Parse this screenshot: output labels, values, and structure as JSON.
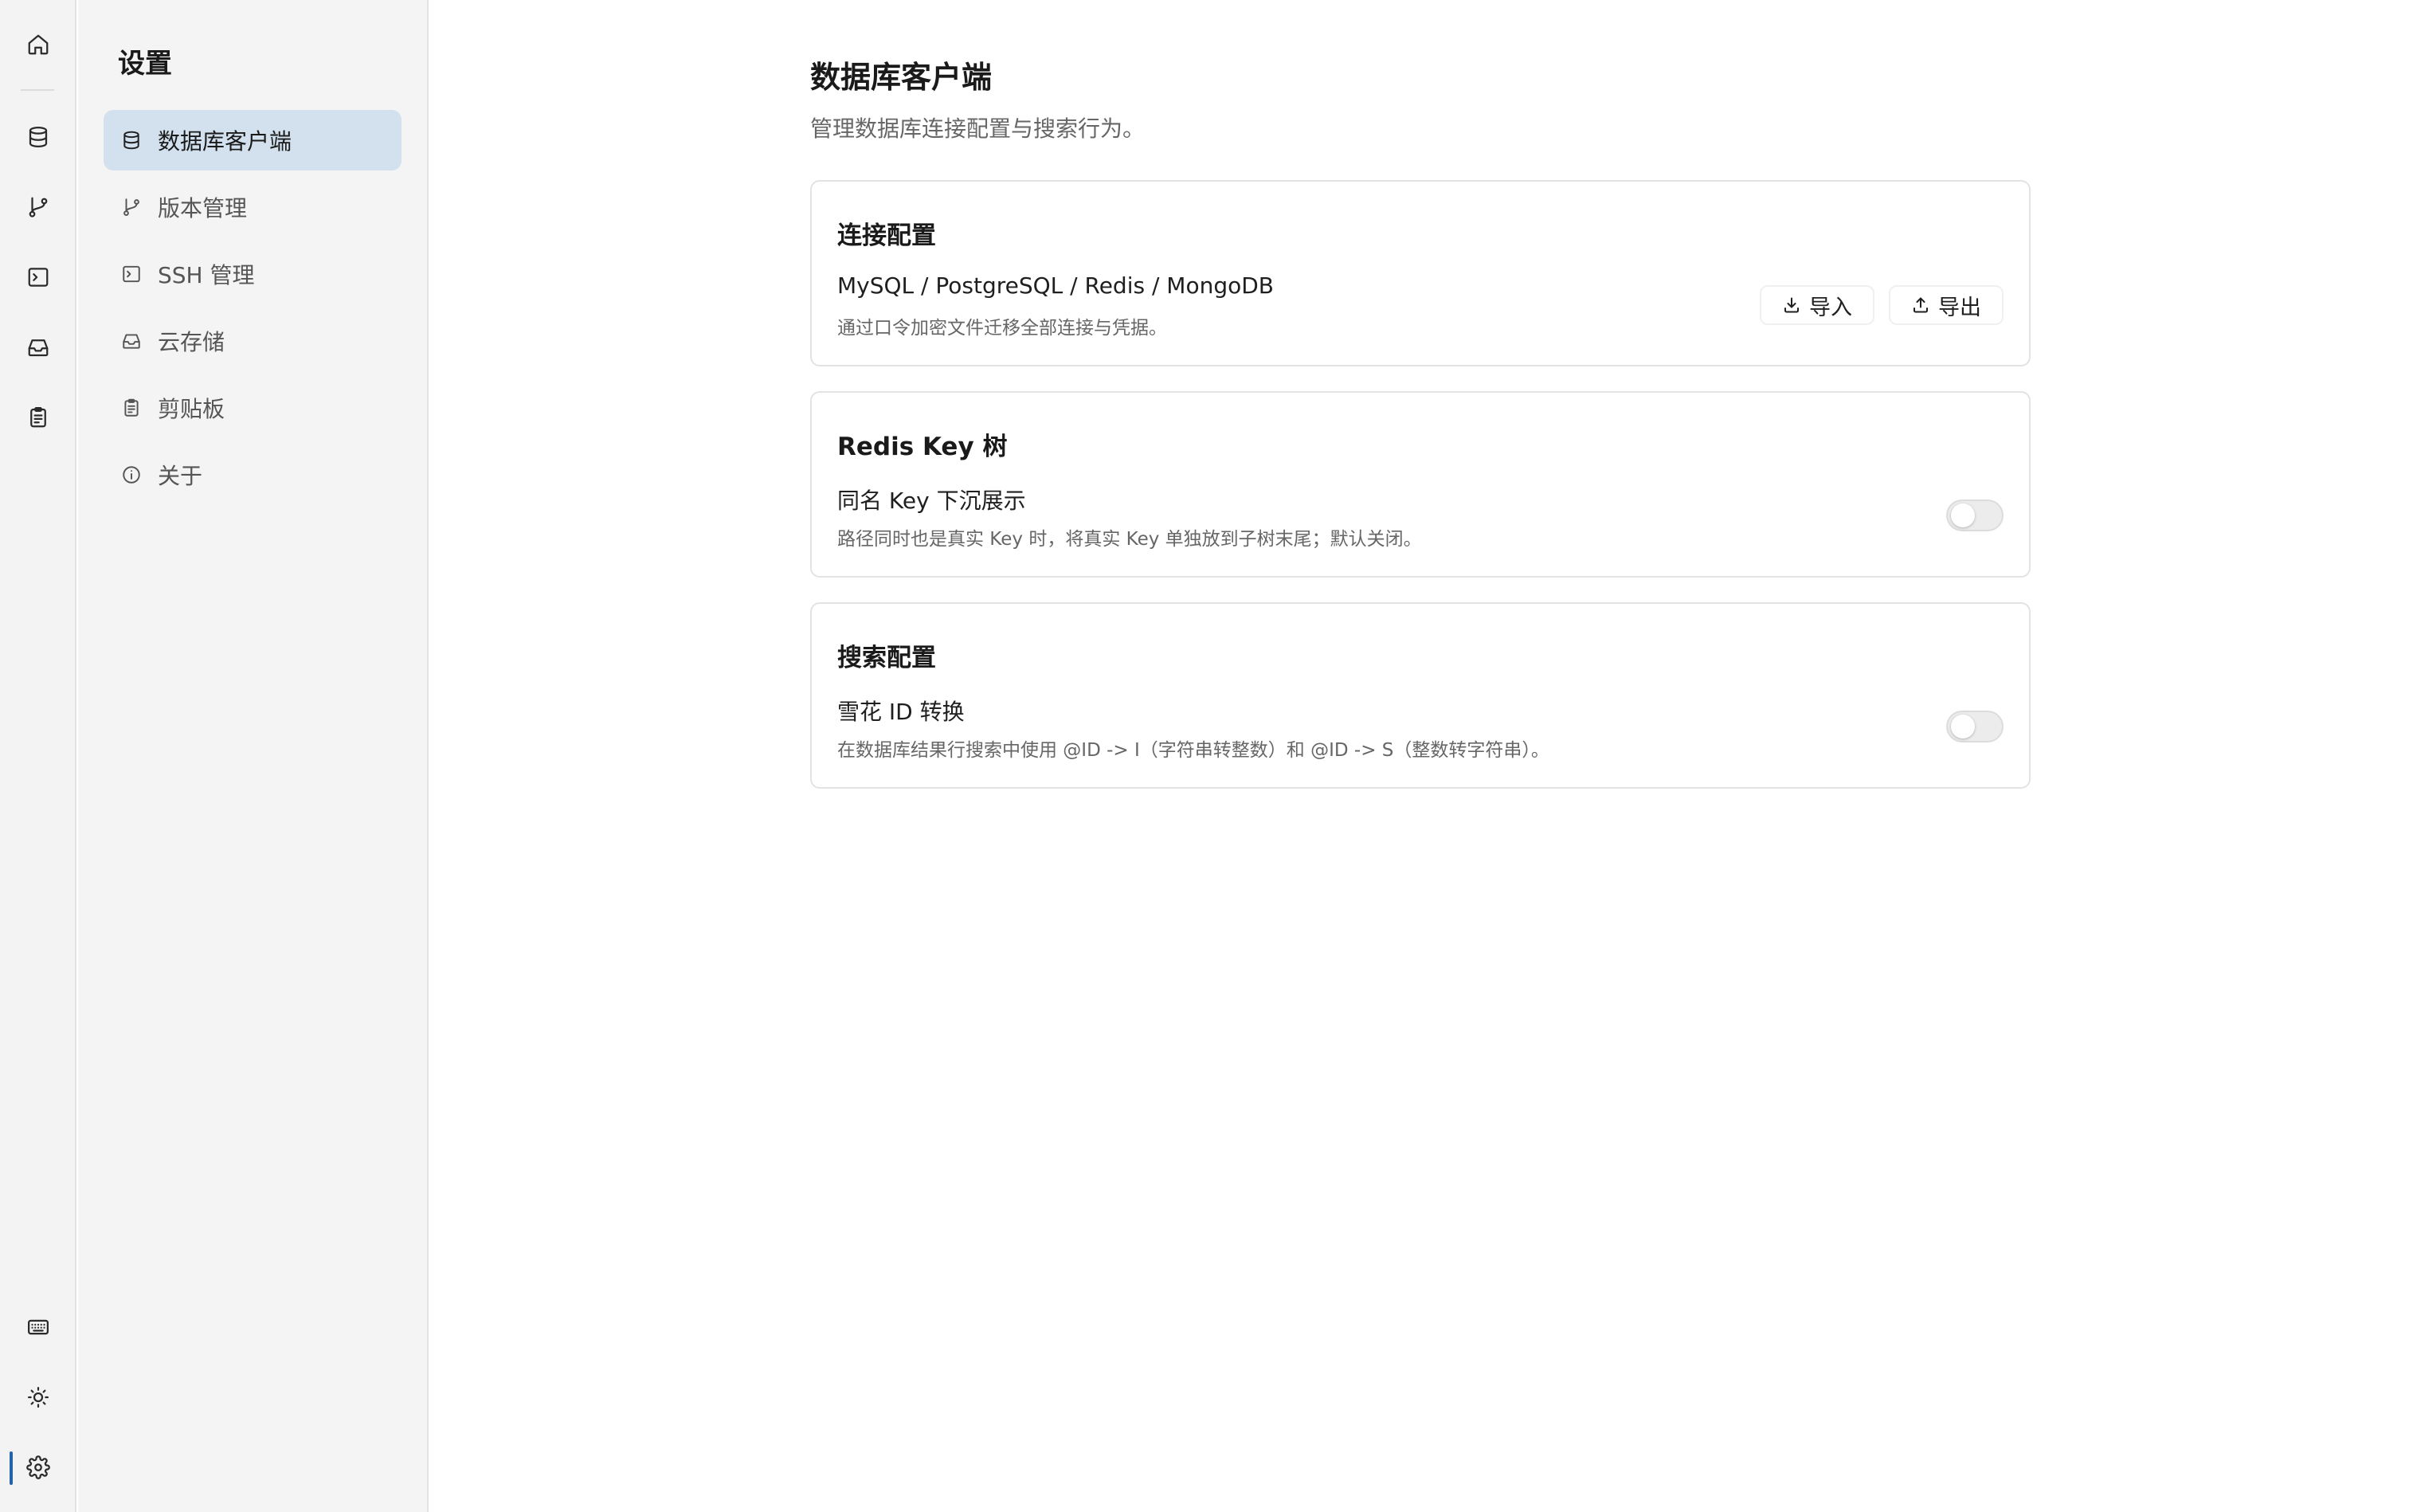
{
  "rail": {
    "items": [
      "home-icon",
      "database-icon",
      "git-branch-icon",
      "terminal-icon",
      "inbox-icon",
      "clipboard-icon"
    ],
    "bottom": [
      "keyboard-icon",
      "sun-icon",
      "gear-icon"
    ],
    "accent": "#2563a8"
  },
  "sidebar": {
    "title": "设置",
    "items": [
      {
        "label": "数据库客户端",
        "icon": "database-icon",
        "active": true
      },
      {
        "label": "版本管理",
        "icon": "git-branch-icon"
      },
      {
        "label": "SSH 管理",
        "icon": "terminal-icon"
      },
      {
        "label": "云存储",
        "icon": "inbox-icon"
      },
      {
        "label": "剪贴板",
        "icon": "clipboard-icon"
      },
      {
        "label": "关于",
        "icon": "info-icon"
      }
    ],
    "active_bg": "#d3e1ee"
  },
  "main": {
    "title": "数据库客户端",
    "subtitle": "管理数据库连接配置与搜索行为。",
    "sections": [
      {
        "title": "连接配置",
        "row_label": "MySQL / PostgreSQL / Redis / MongoDB",
        "row_desc": "通过口令加密文件迁移全部连接与凭据。",
        "import_label": "导入",
        "export_label": "导出"
      },
      {
        "title": "Redis Key 树",
        "row_label": "同名 Key 下沉展示",
        "row_desc": "路径同时也是真实 Key 时，将真实 Key 单独放到子树末尾；默认关闭。",
        "toggle_on": false
      },
      {
        "title": "搜索配置",
        "row_label": "雪花 ID 转换",
        "row_desc": "在数据库结果行搜索中使用 @ID -> I（字符串转整数）和 @ID -> S（整数转字符串）。",
        "toggle_on": false
      }
    ]
  }
}
